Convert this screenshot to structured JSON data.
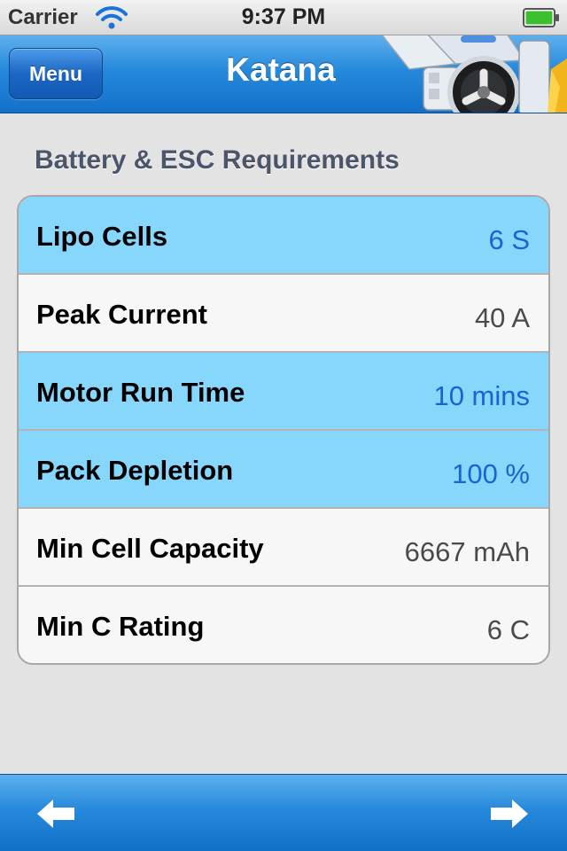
{
  "status_bar": {
    "carrier": "Carrier",
    "time": "9:37 PM",
    "wifi_icon": "wifi-icon",
    "battery_icon": "battery-icon",
    "battery_level": 1.0,
    "battery_color": "#3ac02c"
  },
  "nav": {
    "title": "Katana",
    "menu_label": "Menu",
    "accent": "#2689db"
  },
  "section": {
    "header": "Battery & ESC Requirements"
  },
  "rows": [
    {
      "label": "Lipo Cells",
      "value": "6 S",
      "highlighted": true
    },
    {
      "label": "Peak Current",
      "value": "40 A",
      "highlighted": false
    },
    {
      "label": "Motor Run Time",
      "value": "10 mins",
      "highlighted": true
    },
    {
      "label": "Pack Depletion",
      "value": "100 %",
      "highlighted": true
    },
    {
      "label": "Min Cell Capacity",
      "value": "6667 mAh",
      "highlighted": false
    },
    {
      "label": "Min C Rating",
      "value": "6 C",
      "highlighted": false
    }
  ],
  "toolbar": {
    "back_icon": "arrow-left-icon",
    "forward_icon": "arrow-right-icon"
  },
  "colors": {
    "highlight_row": "#87d6fc",
    "highlight_value": "#1b62d4",
    "plain_row": "#f7f7f7"
  }
}
